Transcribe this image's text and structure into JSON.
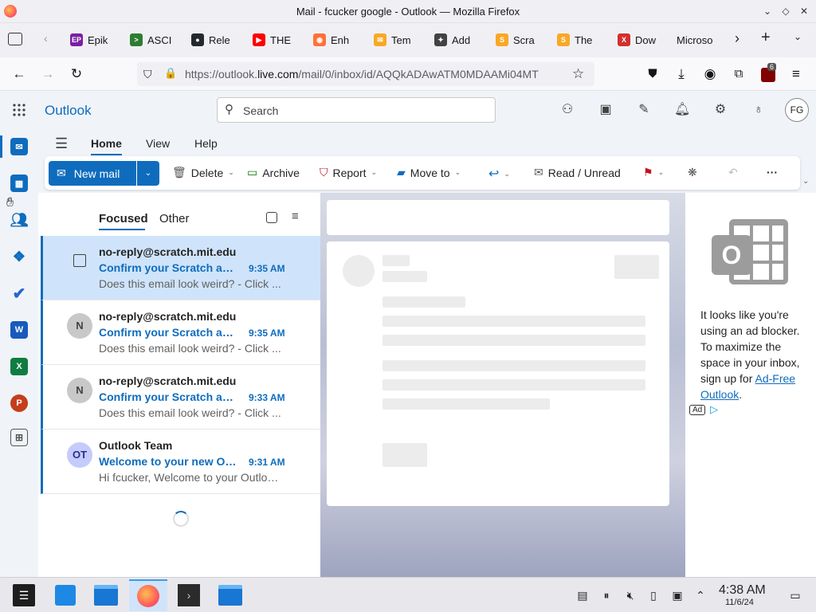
{
  "window": {
    "title": "Mail - fcucker google - Outlook — Mozilla Firefox"
  },
  "tabs": [
    {
      "label": "Epik",
      "icon": "epik-icon",
      "color": "#7b1fa2"
    },
    {
      "label": "ASCI",
      "icon": "terminal-icon",
      "color": "#2e7d32"
    },
    {
      "label": "Rele",
      "icon": "github-icon",
      "color": "#24292f"
    },
    {
      "label": "THE",
      "icon": "youtube-icon",
      "color": "#ff0000"
    },
    {
      "label": "Enh",
      "icon": "firefox-icon",
      "color": "#ff7139"
    },
    {
      "label": "Tem",
      "icon": "mail-icon",
      "color": "#f9a825"
    },
    {
      "label": "Add",
      "icon": "puzzle-icon",
      "color": "#424242"
    },
    {
      "label": "Scra",
      "icon": "scratch-icon",
      "color": "#f9a825"
    },
    {
      "label": "The",
      "icon": "scratch-icon",
      "color": "#f9a825"
    },
    {
      "label": "Dow",
      "icon": "x-icon",
      "color": "#d32f2f"
    },
    {
      "label": "Microso",
      "icon": "",
      "color": "#0078d4"
    }
  ],
  "urlbar": {
    "url_prefix": "https://outlook.",
    "url_domain": "live.com",
    "url_rest": "/mail/0/inbox/id/AQQkADAwATM0MDAAMi04MT"
  },
  "extension_badge": "6",
  "app": {
    "name": "Outlook",
    "search_placeholder": "Search",
    "user_initials": "FG"
  },
  "ribbon_tabs": [
    "Home",
    "View",
    "Help"
  ],
  "ribbon": {
    "new_mail": "New mail",
    "delete": "Delete",
    "archive": "Archive",
    "report": "Report",
    "move_to": "Move to",
    "read_unread": "Read / Unread",
    "more": "···"
  },
  "list_tabs": {
    "focused": "Focused",
    "other": "Other"
  },
  "messages": [
    {
      "sender": "no-reply@scratch.mit.edu",
      "subject": "Confirm your Scratch acc...",
      "time": "9:35 AM",
      "preview": "Does this email look weird? - Click ...",
      "avatar": ""
    },
    {
      "sender": "no-reply@scratch.mit.edu",
      "subject": "Confirm your Scratch acc...",
      "time": "9:35 AM",
      "preview": "Does this email look weird? - Click ...",
      "avatar": "N"
    },
    {
      "sender": "no-reply@scratch.mit.edu",
      "subject": "Confirm your Scratch acc...",
      "time": "9:33 AM",
      "preview": "Does this email look weird? - Click ...",
      "avatar": "N"
    },
    {
      "sender": "Outlook Team",
      "subject": "Welcome to your new Ou...",
      "time": "9:31 AM",
      "preview": "Hi fcucker, Welcome to your Outloo...",
      "avatar": "OT"
    }
  ],
  "ad": {
    "text": "It looks like you're using an ad blocker. To maximize the space in your inbox, sign up for ",
    "link": "Ad-Free Outlook",
    "end": ".",
    "badge": "Ad"
  },
  "clock": {
    "time": "4:38 AM",
    "date": "11/6/24"
  },
  "colors": {
    "accent": "#0f6cbd",
    "selected": "#cfe4fa"
  }
}
